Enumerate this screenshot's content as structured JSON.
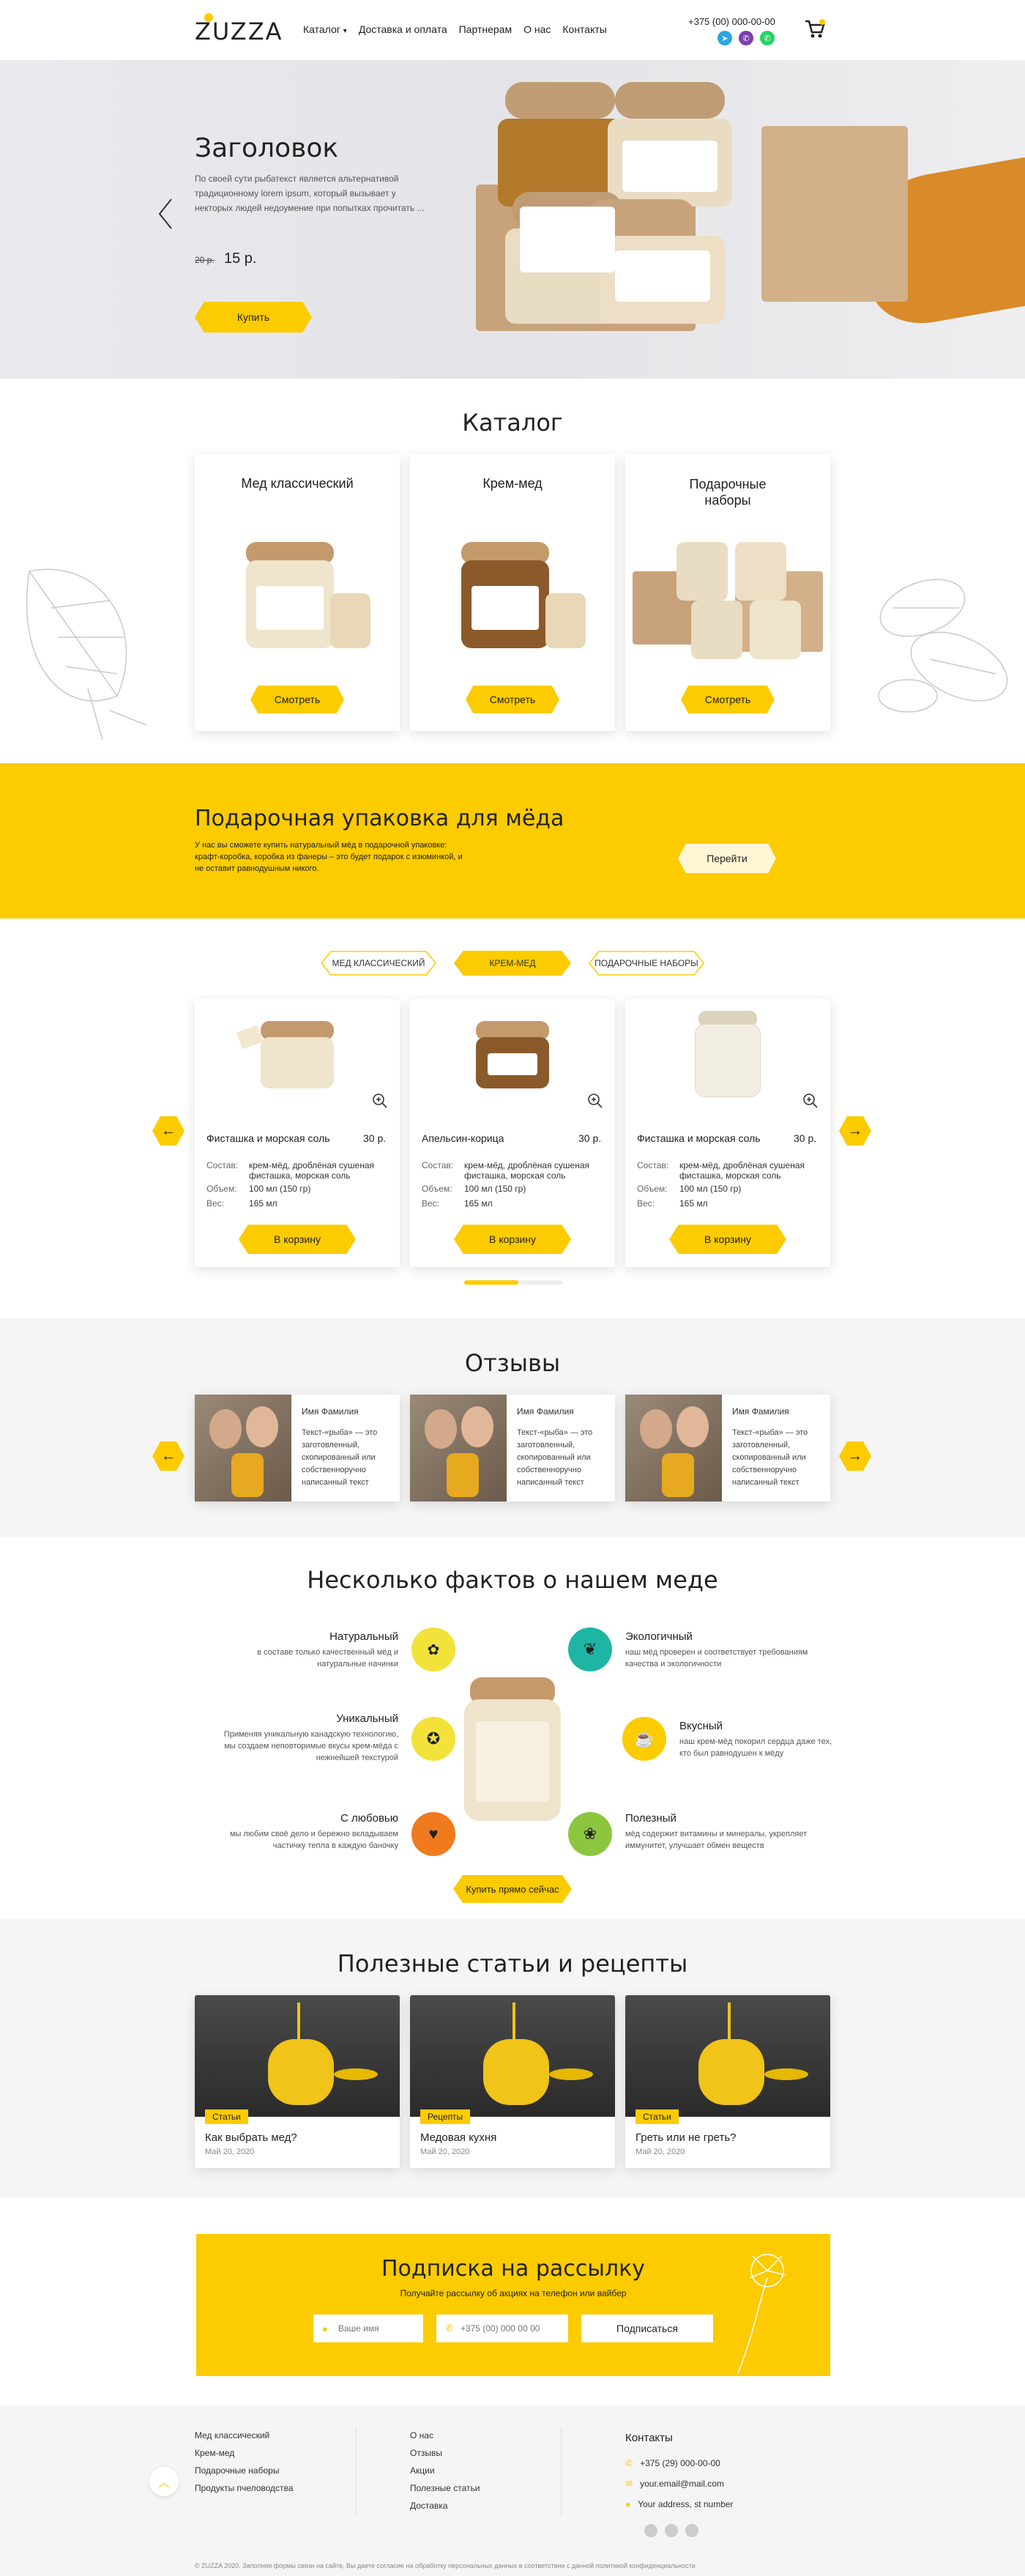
{
  "header": {
    "logo": "ZUZZA",
    "nav": [
      "Каталог",
      "Доставка и оплата",
      "Партнерам",
      "О нас",
      "Контакты"
    ],
    "phone": "+375 (00) 000-00-00"
  },
  "hero": {
    "title": "Заголовок",
    "text": "По своей сути рыбатекст является альтернативой традиционному lorem ipsum, который вызывает у некторых людей недоумение при попытках прочитать ...",
    "old_price": "20 р.",
    "price": "15 р.",
    "button": "Купить"
  },
  "catalog": {
    "title": "Каталог",
    "items": [
      {
        "name": "Мед классический",
        "button": "Смотреть"
      },
      {
        "name": "Крем-мед",
        "button": "Смотреть"
      },
      {
        "name": "Подарочные наборы",
        "button": "Смотреть"
      }
    ]
  },
  "gift": {
    "title": "Подарочная упаковка для мёда",
    "text": "У нас вы сможете купить натуральный мёд в подарочной упаковке: крафт-коробка, коробка из фанеры – это будет подарок с изюминкой, и не оставит равнодушным никого.",
    "button": "Перейти"
  },
  "products": {
    "tabs": [
      "Мед классический",
      "Крем-мед",
      "Подарочные наборы"
    ],
    "labels": {
      "composition": "Состав:",
      "volume": "Объем:",
      "weight": "Вес:"
    },
    "items": [
      {
        "name": "Фисташка и морская соль",
        "price": "30 р.",
        "composition": "крем-мёд, дроблёная сушеная фисташка, морская соль",
        "volume": "100 мл (150 гр)",
        "weight": "165 мл",
        "button": "В корзину"
      },
      {
        "name": "Апельсин-корица",
        "price": "30 р.",
        "composition": "крем-мёд, дроблёная сушеная фисташка, морская соль",
        "volume": "100 мл (150 гр)",
        "weight": "165 мл",
        "button": "В корзину"
      },
      {
        "name": "Фисташка и морская соль",
        "price": "30 р.",
        "composition": "крем-мёд, дроблёная сушеная фисташка, морская соль",
        "volume": "100 мл (150 гр)",
        "weight": "165 мл",
        "button": "В корзину"
      }
    ]
  },
  "reviews": {
    "title": "Отзывы",
    "items": [
      {
        "name": "Имя Фамилия",
        "text": "Текст-«рыба» — это заготовленный, скопированный или собственноручно написанный текст"
      },
      {
        "name": "Имя Фамилия",
        "text": "Текст-«рыба» — это заготовленный, скопированный или собственноручно написанный текст"
      },
      {
        "name": "Имя Фамилия",
        "text": "Текст-«рыба» — это заготовленный, скопированный или собственноручно написанный текст"
      }
    ]
  },
  "facts": {
    "title": "Несколько фактов о нашем меде",
    "left": [
      {
        "title": "Натуральный",
        "text": "в составе только качественный мёд и натуральные начинки",
        "color": "#f2e23a"
      },
      {
        "title": "Уникальный",
        "text": "Применяя уникальную канадскую технологию, мы создаем неповторимые вкусы крем-мёда с нежнейшей текстурой",
        "color": "#f2e23a"
      },
      {
        "title": "С любовью",
        "text": "мы любим своё дело и бережно вкладываем частичку тепла в каждую баночку",
        "color": "#f07a1e"
      }
    ],
    "right": [
      {
        "title": "Экологичный",
        "text": "наш мёд проверен и соответствует требованиям качества и экологичности",
        "color": "#1fb5a4"
      },
      {
        "title": "Вкусный",
        "text": "наш крем-мёд покорил сердца даже тех, кто был равнодушен к мёду",
        "color": "#fccb00"
      },
      {
        "title": "Полезный",
        "text": "мёд содержит витамины и минералы, укрепляет иммунитет, улучшает обмен веществ",
        "color": "#8cc63f"
      }
    ],
    "button": "Купить прямо сейчас"
  },
  "articles": {
    "title": "Полезные статьи и рецепты",
    "items": [
      {
        "tag": "Статьи",
        "title": "Как выбрать мед?",
        "date": "Май 20, 2020"
      },
      {
        "tag": "Рецепты",
        "title": "Медовая кухня",
        "date": "Май 20, 2020"
      },
      {
        "tag": "Статьи",
        "title": "Греть или не греть?",
        "date": "Май 20, 2020"
      }
    ]
  },
  "subscribe": {
    "title": "Подписка на рассылку",
    "subtitle": "Получайте рассылку об акциях на телефон или вайбер",
    "name_placeholder": "Ваше имя",
    "phone_placeholder": "+375 (00) 000 00 00",
    "button": "Подписаться"
  },
  "footer": {
    "col1": [
      "Мед классический",
      "Крем-мед",
      "Подарочные наборы",
      "Продукты пчеловодства"
    ],
    "col2": [
      "О нас",
      "Отзывы",
      "Акции",
      "Полезные статьи",
      "Доставка"
    ],
    "contacts_title": "Контакты",
    "phone": "+375 (29) 000-00-00",
    "email": "your.email@mail.com",
    "address": "Your address, st number",
    "copyright": "© ZUZZA 2020. Заполняя формы связи на сайте, Вы даете согласие на обработку персональных данных в соответствии с данной политикой конфиденциальности"
  },
  "colors": {
    "accent": "#fccb00",
    "bg_gray": "#f5f5f5"
  }
}
